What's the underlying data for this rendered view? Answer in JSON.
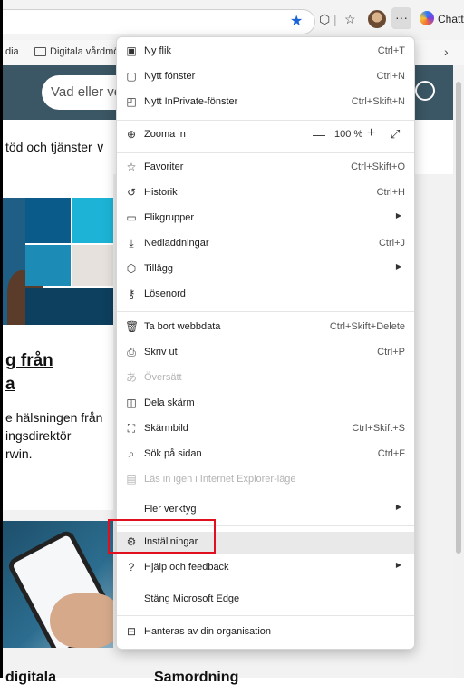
{
  "browser": {
    "chat_label": "Chatt",
    "accent_color": "#1a63d6"
  },
  "favorites_bar": {
    "left_fragment": "dia",
    "folder_label": "Digitala vårdmöte"
  },
  "site": {
    "search_placeholder": "Vad eller ve",
    "nav_fragment": "töd och tjänster ∨",
    "headline_lines": [
      "g från",
      "a"
    ],
    "body_lines": [
      "e hälsningen från",
      "ingsdirektör",
      "rwin."
    ],
    "bottom_left": "digitala",
    "bottom_right": "Samordning"
  },
  "menu": {
    "items": [
      {
        "label": "Ny flik",
        "shortcut": "Ctrl+T",
        "icon": "new-tab-icon"
      },
      {
        "label": "Nytt fönster",
        "shortcut": "Ctrl+N",
        "icon": "new-window-icon"
      },
      {
        "label": "Nytt InPrivate-fönster",
        "shortcut": "Ctrl+Skift+N",
        "icon": "inprivate-icon"
      },
      {
        "label": "Zooma in",
        "icon": "zoom-icon",
        "zoom_value": "100 %"
      },
      {
        "label": "Favoriter",
        "shortcut": "Ctrl+Skift+O",
        "icon": "favorites-icon"
      },
      {
        "label": "Historik",
        "shortcut": "Ctrl+H",
        "icon": "history-icon"
      },
      {
        "label": "Flikgrupper",
        "icon": "tab-groups-icon"
      },
      {
        "label": "Nedladdningar",
        "shortcut": "Ctrl+J",
        "icon": "download-icon"
      },
      {
        "label": "Tillägg",
        "icon": "extensions-icon"
      },
      {
        "label": "Lösenord",
        "icon": "password-icon"
      },
      {
        "label": "Ta bort webbdata",
        "shortcut": "Ctrl+Skift+Delete",
        "icon": "trash-icon"
      },
      {
        "label": "Skriv ut",
        "shortcut": "Ctrl+P",
        "icon": "print-icon"
      },
      {
        "label": "Översätt",
        "icon": "translate-icon"
      },
      {
        "label": "Dela skärm",
        "icon": "split-screen-icon"
      },
      {
        "label": "Skärmbild",
        "shortcut": "Ctrl+Skift+S",
        "icon": "screenshot-icon"
      },
      {
        "label": "Sök på sidan",
        "shortcut": "Ctrl+F",
        "icon": "find-icon"
      },
      {
        "label": "Läs in igen i Internet Explorer-läge",
        "icon": "ie-mode-icon"
      },
      {
        "label": "Fler verktyg"
      },
      {
        "label": "Inställningar",
        "icon": "settings-icon"
      },
      {
        "label": "Hjälp och feedback",
        "icon": "help-icon"
      },
      {
        "label": "Stäng Microsoft Edge"
      },
      {
        "label": "Hanteras av din organisation",
        "icon": "organization-icon"
      }
    ]
  },
  "highlight_color": "#e0101e"
}
